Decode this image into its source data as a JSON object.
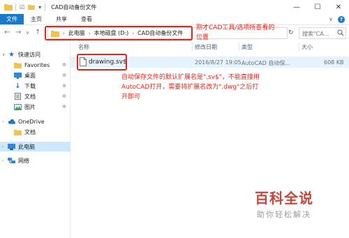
{
  "window": {
    "title": "CAD自动备份文件",
    "controls": [
      "—",
      "☐",
      "✕"
    ]
  },
  "ribbon": {
    "tabs": [
      "文件",
      "主页",
      "共享",
      "查看"
    ],
    "expand": "∨",
    "help": "?"
  },
  "address": {
    "crumbs": [
      "此电脑",
      "本地磁盘 (D:)",
      "CAD自动备份文件"
    ],
    "search_placeholder": "搜索\"CA...",
    "accent_color": "#e0261b"
  },
  "sidebar": {
    "items": [
      {
        "label": "快速访问",
        "icon": "star-icon"
      },
      {
        "label": "Favorites",
        "icon": "folder-icon",
        "pinned": true
      },
      {
        "label": "桌面",
        "icon": "desktop-icon",
        "pinned": true
      },
      {
        "label": "下载",
        "icon": "download-icon",
        "pinned": true
      },
      {
        "label": "文档",
        "icon": "document-icon",
        "pinned": true
      },
      {
        "label": "图片",
        "icon": "picture-icon",
        "pinned": true
      },
      {
        "label": "OneDrive",
        "icon": "cloud-icon"
      },
      {
        "label": "文档",
        "icon": "folder-icon"
      },
      {
        "label": "此电脑",
        "icon": "computer-icon",
        "selected": true
      },
      {
        "label": "网络",
        "icon": "network-icon"
      }
    ]
  },
  "columns": {
    "name": "名称",
    "modified": "修改日期",
    "type": "类型",
    "size": "大小"
  },
  "files": [
    {
      "name": "drawing.sv$",
      "modified": "2016/8/27 19:05",
      "type": "AutoCAD 自动保...",
      "size": "608 KB"
    }
  ],
  "annotations": {
    "path_note": "刚才CAD工具/选项所查看的位置",
    "file_note": "自动保存文件的默认扩展名是\".sv$\"，不能直接用AutoCAD打开，需要将扩展名改为\".dwg\"之后打开即可"
  },
  "watermark": {
    "main": "百科全说",
    "sub": "助你轻松解决"
  }
}
